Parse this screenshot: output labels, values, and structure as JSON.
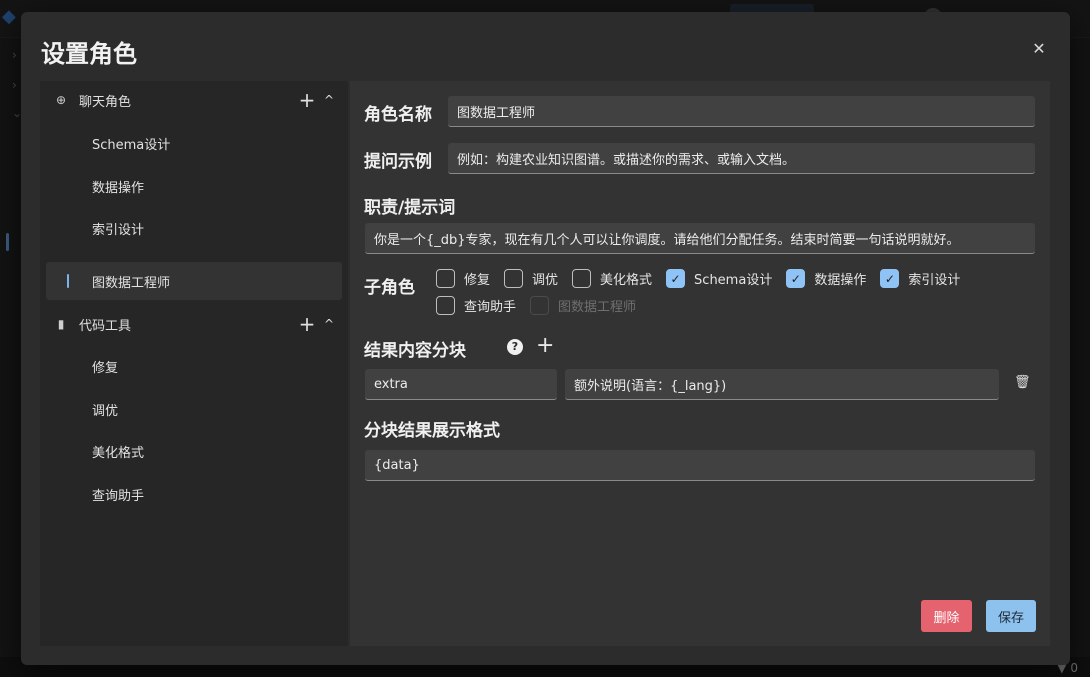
{
  "dialog": {
    "title": "设置角色",
    "close_icon": "close-icon"
  },
  "sidebar": {
    "groups": [
      {
        "label": "聊天角色",
        "icon": "robot-icon",
        "items": [
          "Schema设计",
          "数据操作",
          "索引设计",
          "图数据工程师"
        ],
        "active_index": 3
      },
      {
        "label": "代码工具",
        "icon": "code-tool-icon",
        "items": [
          "修复",
          "调优",
          "美化格式",
          "查询助手"
        ]
      }
    ]
  },
  "form": {
    "role_name_label": "角色名称",
    "role_name_value": "图数据工程师",
    "example_label": "提问示例",
    "example_value": "例如：构建农业知识图谱。或描述你的需求、或输入文档。",
    "prompt_label": "职责/提示词",
    "prompt_value": "你是一个{_db}专家，现在有几个人可以让你调度。请给他们分配任务。结束时简要一句话说明就好。",
    "subroles_label": "子角色",
    "subroles": [
      {
        "label": "修复",
        "checked": false,
        "disabled": false
      },
      {
        "label": "调优",
        "checked": false,
        "disabled": false
      },
      {
        "label": "美化格式",
        "checked": false,
        "disabled": false
      },
      {
        "label": "Schema设计",
        "checked": true,
        "disabled": false
      },
      {
        "label": "数据操作",
        "checked": true,
        "disabled": false
      },
      {
        "label": "索引设计",
        "checked": true,
        "disabled": false
      },
      {
        "label": "查询助手",
        "checked": false,
        "disabled": false
      },
      {
        "label": "图数据工程师",
        "checked": false,
        "disabled": true
      }
    ],
    "blocks_label": "结果内容分块",
    "block_key": "extra",
    "block_desc": "额外说明(语言：{_lang})",
    "display_label": "分块结果展示格式",
    "display_value": "{data}"
  },
  "buttons": {
    "delete": "删除",
    "save": "保存"
  },
  "status": {
    "filter_count": "0"
  },
  "colors": {
    "accent": "#8fc3f5",
    "danger": "#e5636f",
    "dialog_bg": "#2c2c2c",
    "sidebar_bg": "#262626",
    "main_bg": "#333333"
  }
}
